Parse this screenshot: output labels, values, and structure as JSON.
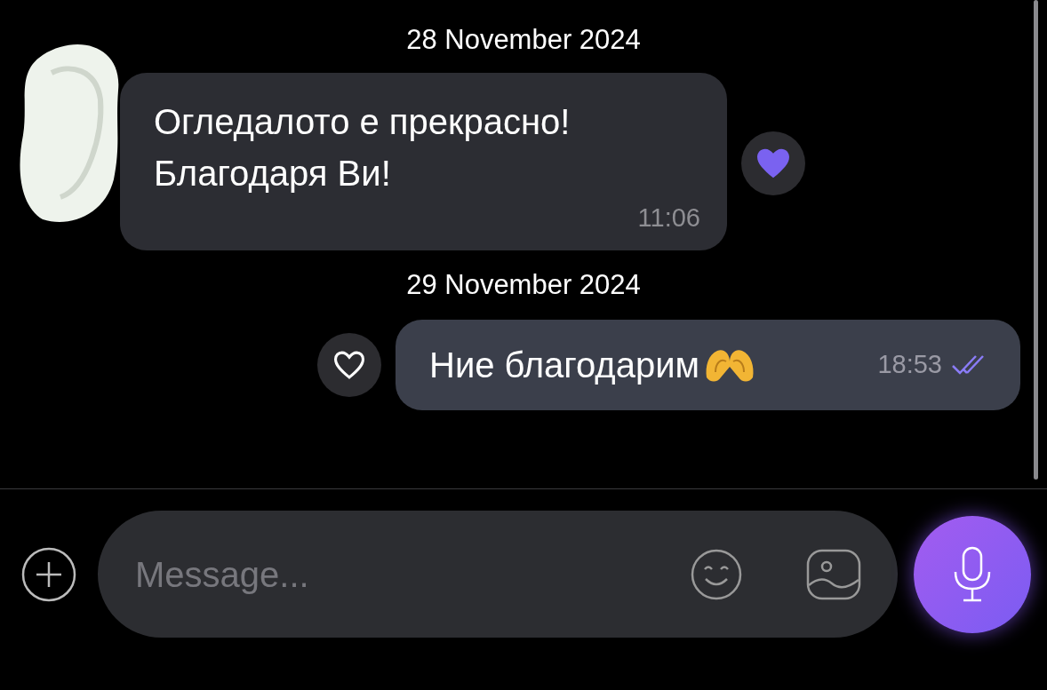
{
  "messages": [
    {
      "kind": "date",
      "text": "28 November 2024"
    },
    {
      "kind": "incoming",
      "text": "Огледалото е прекрасно! Благодаря Ви!",
      "time": "11:06",
      "reacted": true
    },
    {
      "kind": "date",
      "text": "29 November 2024"
    },
    {
      "kind": "outgoing",
      "text": "Ние благодарим",
      "time": "18:53",
      "reacted": false,
      "read": true
    }
  ],
  "composer": {
    "placeholder": "Message..."
  }
}
